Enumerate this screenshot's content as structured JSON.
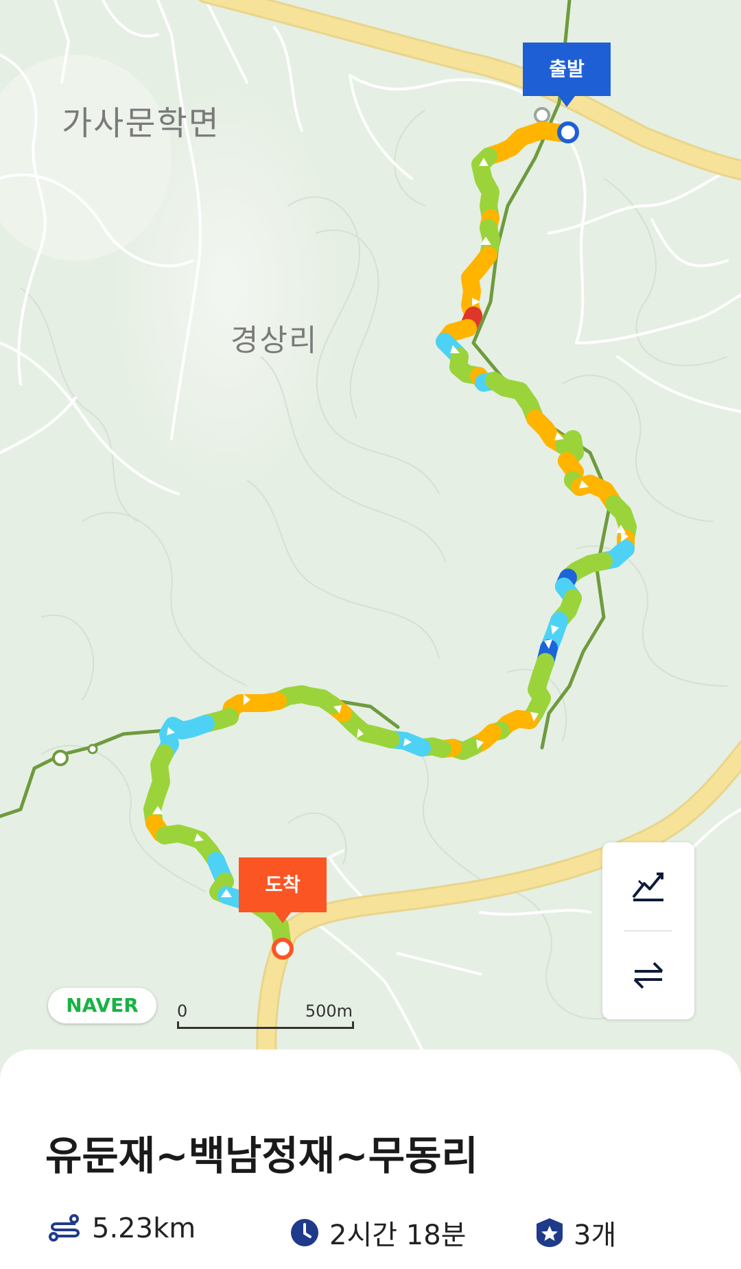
{
  "map": {
    "places": [
      {
        "name": "가사문학면"
      },
      {
        "name": "경상리"
      }
    ],
    "start_label": "출발",
    "end_label": "도착",
    "logo": "NAVER",
    "scale_start": "0",
    "scale_end": "500m"
  },
  "controls": [
    {
      "icon": "elevation-chart-icon"
    },
    {
      "icon": "swap-direction-icon"
    }
  ],
  "course": {
    "title": "유둔재~백남정재~무동리",
    "distance": "5.23km",
    "duration": "2시간 18분",
    "stamps": "3개"
  },
  "colors": {
    "route_green": "#9ad43a",
    "route_orange": "#ffb400",
    "route_cyan": "#4dd2f5",
    "route_blue": "#1d64d8",
    "route_red": "#e0352b",
    "trail": "#6e9b3e",
    "road": "#f7e29a",
    "start": "#1e5fd6",
    "end": "#fb5524",
    "stat_icon": "#1f3a8a"
  }
}
